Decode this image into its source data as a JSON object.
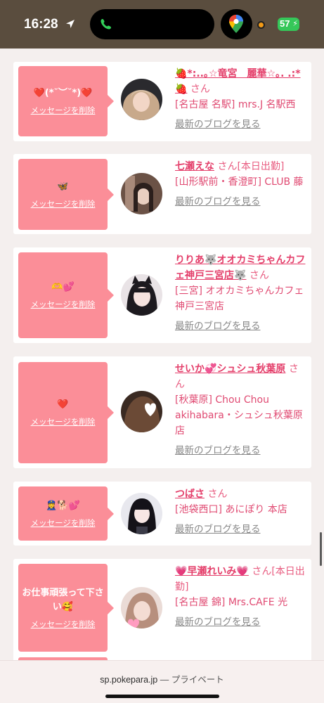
{
  "status_bar": {
    "time": "16:28",
    "battery": "57",
    "colors": {
      "bg": "#5a4d3e",
      "battery": "#35c759",
      "dot": "#f29a16"
    }
  },
  "cards": [
    {
      "message": "❤️(*˘︶˘*)❤️",
      "delete_label": "メッセージを削除",
      "name": "🍓*:..｡☆竜宮　麗華☆｡. .:* 🍓",
      "san": "さん",
      "shop": "[名古屋 名駅] mrs.J 名駅西",
      "blog_link": "最新のブログを見る"
    },
    {
      "message": "🦋",
      "delete_label": "メッセージを削除",
      "name": "七瀬えな",
      "san": "さん[本日出勤]",
      "shop": "[山形駅前・香澄町] CLUB 藤",
      "blog_link": "最新のブログを見る"
    },
    {
      "message": "🫶💕",
      "delete_label": "メッセージを削除",
      "name": "りりあ🐺オオカミちゃんカフェ神戸三宮店🐺",
      "san": "さん",
      "shop": "[三宮] オオカミちゃんカフェ神戸三宮店",
      "blog_link": "最新のブログを見る"
    },
    {
      "message": "❤️",
      "delete_label": "メッセージを削除",
      "name": "せいか💞シュシュ秋葉原",
      "san": "さん",
      "shop": "[秋葉原] Chou Chou akihabara・シュシュ秋葉原店",
      "blog_link": "最新のブログを見る"
    },
    {
      "message": "👮‍♀️🐕💕",
      "delete_label": "メッセージを削除",
      "name": "つばさ",
      "san": "さん",
      "shop": "[池袋西口] あにぽり 本店",
      "blog_link": "最新のブログを見る"
    },
    {
      "message": "お仕事頑張って下さい🥰",
      "delete_label": "メッセージを削除",
      "name": "💗早瀬れいみ💗",
      "san": "さん[本日出勤]",
      "shop": "[名古屋 錦] Mrs.CAFE 光",
      "blog_link": "最新のブログを見る"
    }
  ],
  "browser": {
    "url": "sp.pokepara.jp",
    "separator": " — ",
    "mode": "プライベート"
  },
  "theme": {
    "bubble": "#fb8e98",
    "name": "#e43e6a",
    "shop": "#e04a72",
    "link_gray": "#888888"
  }
}
